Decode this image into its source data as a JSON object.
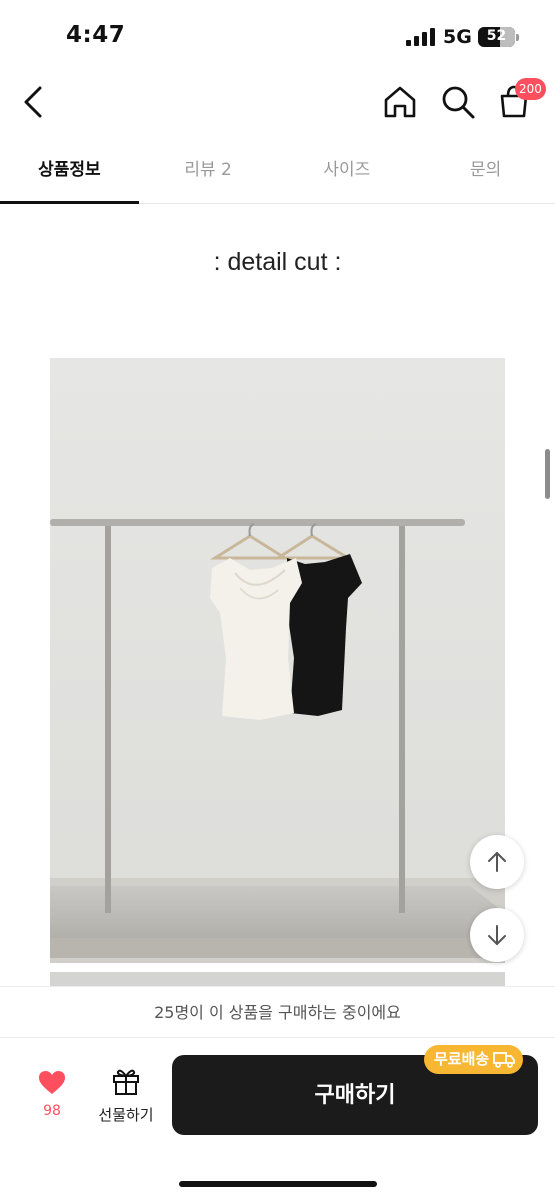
{
  "status_bar": {
    "time": "4:47",
    "network": "5G",
    "battery_level": "52"
  },
  "header": {
    "back_icon": "chevron-left-icon",
    "home_icon": "home-icon",
    "search_icon": "search-icon",
    "cart_icon": "shopping-bag-icon",
    "cart_badge": "200",
    "badge_color": "#ff4f5e"
  },
  "tabs": [
    {
      "label": "상품정보",
      "active": true
    },
    {
      "label": "리뷰 2",
      "active": false
    },
    {
      "label": "사이즈",
      "active": false
    },
    {
      "label": "문의",
      "active": false
    }
  ],
  "content": {
    "detail_title": ": detail cut :",
    "photo_description_icon": "product-photo-clothing-rack"
  },
  "floating_buttons": {
    "up_icon": "arrow-up-icon",
    "down_icon": "arrow-down-icon"
  },
  "notice": {
    "text": "25명이 이 상품을 구매하는 중이에요"
  },
  "bottom_bar": {
    "like_icon": "heart-icon",
    "like_count": "98",
    "like_color": "#ff4f5e",
    "gift_icon": "gift-icon",
    "gift_label": "선물하기",
    "buy_label": "구매하기",
    "buy_color": "#1b1b1b",
    "free_shipping_label": "무료배송",
    "free_shipping_icon": "truck-icon",
    "free_shipping_color": "#f7b733"
  }
}
